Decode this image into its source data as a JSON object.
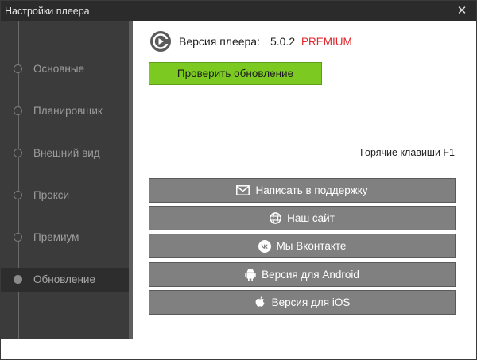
{
  "window": {
    "title": "Настройки плеера",
    "close_glyph": "✕"
  },
  "sidebar": {
    "items": [
      {
        "label": "Основные",
        "active": false
      },
      {
        "label": "Планировщик",
        "active": false
      },
      {
        "label": "Внешний вид",
        "active": false
      },
      {
        "label": "Прокси",
        "active": false
      },
      {
        "label": "Премиум",
        "active": false
      },
      {
        "label": "Обновление",
        "active": true
      }
    ]
  },
  "update": {
    "version_label": "Версия плеера:",
    "version_number": "5.0.2",
    "edition": "PREMIUM",
    "check_button": "Проверить обновление",
    "hotkeys": "Горячие клавиши F1"
  },
  "links": {
    "support": {
      "label": "Написать в поддержку",
      "icon": "mail-icon"
    },
    "site": {
      "label": "Наш сайт",
      "icon": "globe-icon"
    },
    "vk": {
      "label": "Мы Вконтакте",
      "icon": "vk-icon"
    },
    "android": {
      "label": "Версия для Android",
      "icon": "android-icon"
    },
    "ios": {
      "label": "Версия для iOS",
      "icon": "apple-icon"
    }
  },
  "colors": {
    "accent_green": "#7cc922",
    "premium_red": "#e0262d",
    "sidebar_bg": "#3b3b3b",
    "button_gray": "#808080"
  }
}
